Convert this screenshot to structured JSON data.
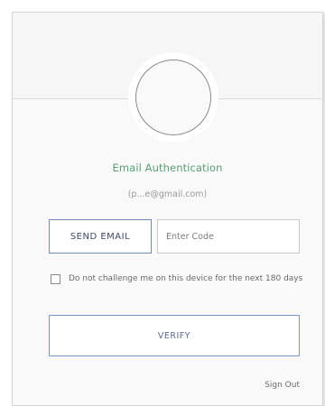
{
  "auth": {
    "title": "Email Authentication",
    "email": "(p...e@gmail.com)",
    "send_email_label": "SEND EMAIL",
    "code_placeholder": "Enter Code",
    "code_value": "",
    "remember_label": "Do not challenge me on this device for the next 180 days",
    "remember_checked": false,
    "verify_label": "VERIFY",
    "sign_out_label": "Sign Out"
  },
  "colors": {
    "title_green": "#5a9e74",
    "button_border_blue": "#6f8bc2"
  }
}
